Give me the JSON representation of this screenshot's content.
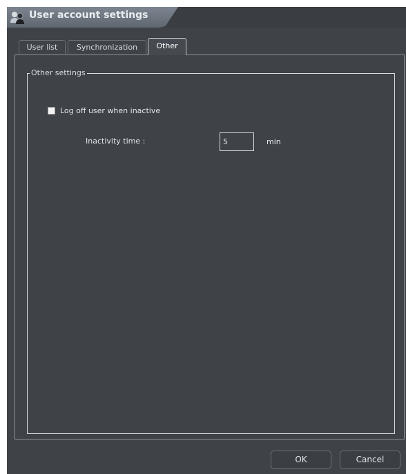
{
  "window": {
    "title": "User account settings",
    "title_icon": "users-icon"
  },
  "tabs": [
    {
      "label": "User list",
      "active": false
    },
    {
      "label": "Synchronization",
      "active": false
    },
    {
      "label": "Other",
      "active": true
    }
  ],
  "other_settings": {
    "group_title": "Other settings",
    "logoff_checkbox": {
      "label": "Log off user when inactive",
      "checked": false
    },
    "inactivity": {
      "label": "Inactivity time :",
      "value": "5",
      "unit": "min"
    }
  },
  "footer": {
    "ok_label": "OK",
    "cancel_label": "Cancel"
  },
  "colors": {
    "window_bg": "#3f4247",
    "title_tab": "#6d757e",
    "text": "#e3e6e9"
  }
}
